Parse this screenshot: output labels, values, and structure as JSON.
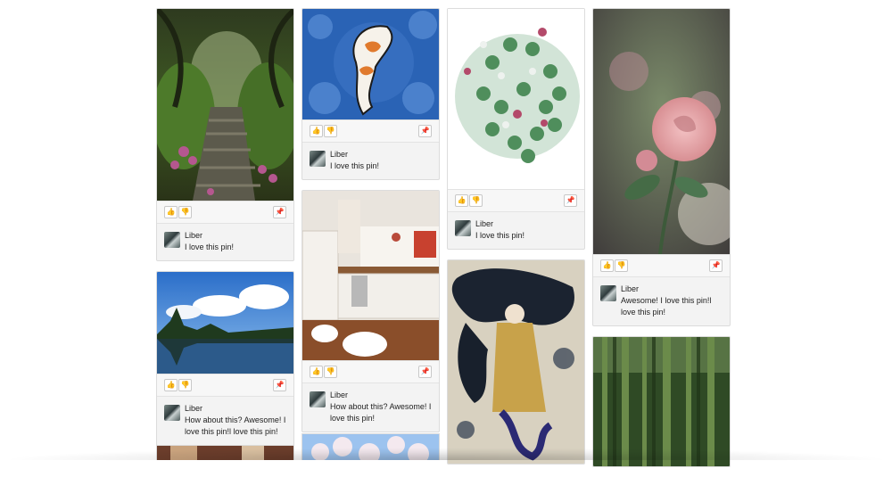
{
  "pins": {
    "p1": {
      "user": "Liber",
      "comment": "I love this pin!"
    },
    "p2": {
      "user": "Liber",
      "comment": "How about this? Awesome! I love this pin!l love this pin!"
    },
    "p3": {
      "user": "Liber",
      "comment": "I love this pin!"
    },
    "p4": {
      "user": "Liber",
      "comment": "How about this? Awesome! I love this pin!"
    },
    "p5": {
      "user": "Liber",
      "comment": "I love this pin!"
    },
    "p6": {
      "user": "Liber",
      "comment": "Awesome! I love this pin!l love this pin!"
    }
  },
  "icons": {
    "like": "thumbs-up-icon",
    "dislike": "thumbs-down-icon",
    "pin": "pushpin-icon"
  },
  "colors": {
    "card_bg": "#f3f3f3",
    "card_border": "#dcdcdc",
    "page_bg": "#ffffff"
  }
}
